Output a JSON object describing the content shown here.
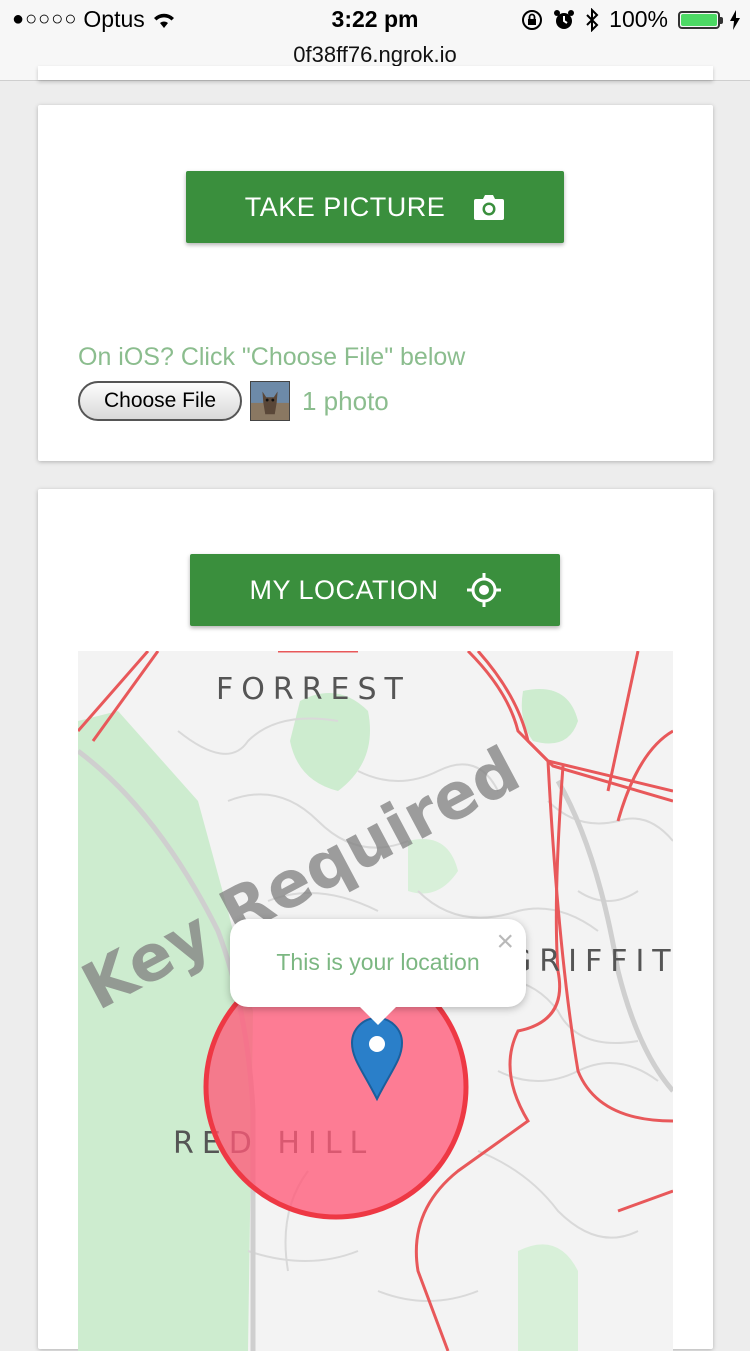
{
  "status_bar": {
    "signal": "●○○○○",
    "carrier": "Optus",
    "time": "3:22 pm",
    "url": "0f38ff76.ngrok.io",
    "battery": "100%",
    "icons": [
      "wifi-icon",
      "orientation-lock-icon",
      "alarm-icon",
      "bluetooth-icon",
      "battery-icon",
      "charging-icon"
    ]
  },
  "camera_card": {
    "take_picture_label": "TAKE PICTURE",
    "button_icon": "camera-icon",
    "ios_hint": "On iOS? Click \"Choose File\" below",
    "choose_file_label": "Choose File",
    "file_status": "1 photo"
  },
  "location_card": {
    "my_location_label": "MY LOCATION",
    "button_icon": "crosshair-icon",
    "map": {
      "labels": [
        "FORREST",
        "RED HILL",
        "GRIFFIT"
      ],
      "watermark": "Key Required",
      "popup_text": "This is your location",
      "popup_close": "×"
    }
  },
  "colors": {
    "button_green": "#3a8f3d",
    "hint_green": "#8bbd8e",
    "accuracy_circle": "#ff5a78",
    "road_red": "#e8585a",
    "park_green": "#cdeccf",
    "marker_blue": "#2a7fc9"
  }
}
